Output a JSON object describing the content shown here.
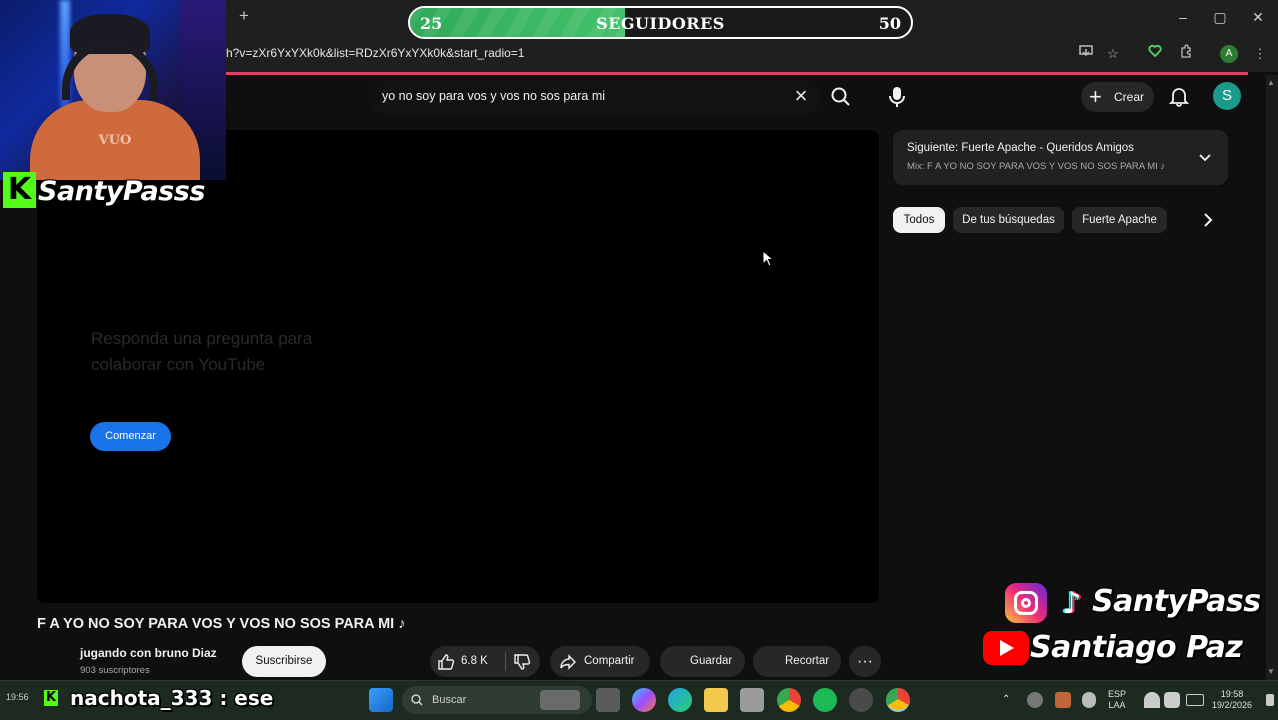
{
  "overlay": {
    "goal": {
      "min": "25",
      "label": "SEGUIDORES",
      "max": "50",
      "progress": 0.43
    },
    "streamer_name": "SantyPasss",
    "social_handle": "SantyPass",
    "youtube_name": "Santiago Paz",
    "chat": {
      "time": "19:56",
      "message": "nachota_333 : ese"
    },
    "shirt_print": "VUO"
  },
  "browser": {
    "url": "h?v=zXr6YxYXk0k&list=RDzXr6YxYXk0k&start_radio=1",
    "window_controls": [
      "–",
      "▢",
      "✕"
    ],
    "new_tab": "+",
    "profile_initial": "A"
  },
  "youtube": {
    "search": {
      "query": "yo no soy para vos y vos no sos para mi"
    },
    "create_label": "Crear",
    "avatar_initial": "S",
    "survey": {
      "question": "Responda una pregunta para colaborar con YouTube",
      "button": "Comenzar"
    },
    "video": {
      "title": "F A YO NO SOY PARA VOS Y VOS NO SOS PARA MI ♪",
      "channel": "jugando con bruno Diaz",
      "subscribers": "903 suscriptores",
      "subscribe_label": "Suscribirse",
      "likes": "6.8 K",
      "share_label": "Compartir",
      "save_label": "Guardar",
      "clip_label": "Recortar"
    },
    "next": {
      "title": "Siguiente: Fuerte Apache - Queridos Amigos",
      "subtitle": "Mix: F A YO NO SOY PARA VOS Y VOS NO SOS PARA MI ♪"
    },
    "chips": [
      "Todos",
      "De tus búsquedas",
      "Fuerte Apache"
    ]
  },
  "taskbar": {
    "search_label": "Buscar",
    "lang_line1": "ESP",
    "lang_line2": "LAA",
    "time": "19:58",
    "date": "19/2/2026"
  },
  "colors": {
    "accent_pink": "#e8396b",
    "goal_green": "#45c06a",
    "kick_green": "#53fc18",
    "yt_blue": "#1a73e8"
  }
}
